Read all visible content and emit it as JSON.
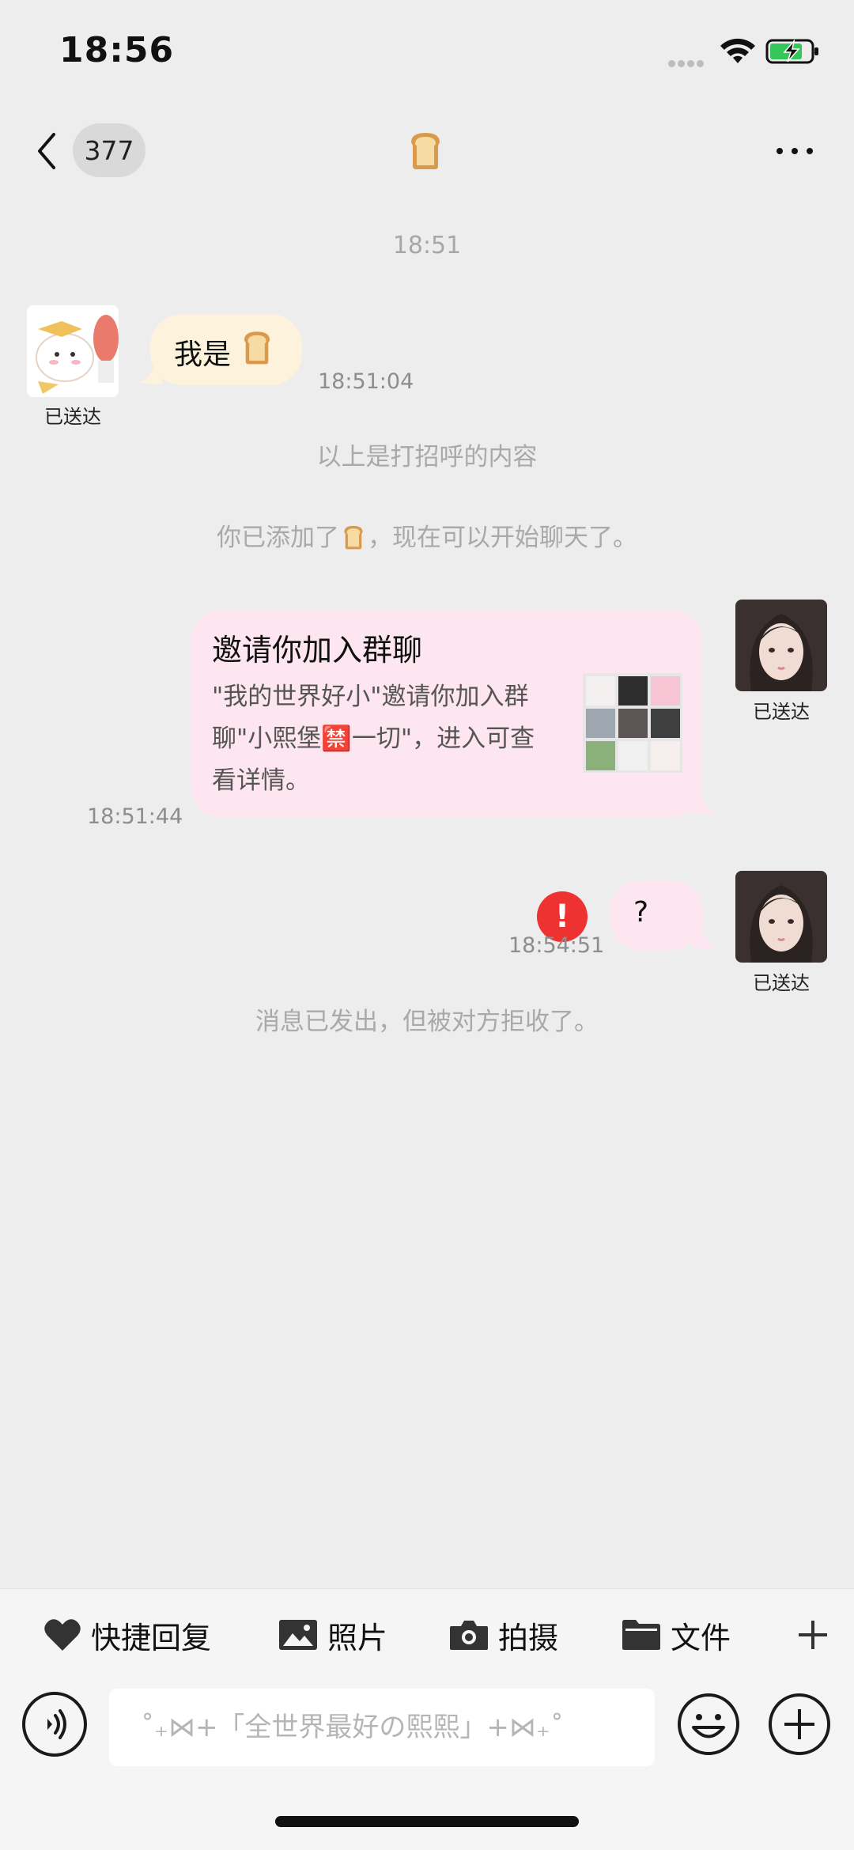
{
  "status_bar": {
    "time": "18:56"
  },
  "nav": {
    "unread_count": "377",
    "title_icon": "bread-emoji"
  },
  "messages": {
    "time_divider": "18:51",
    "incoming": {
      "text": "我是",
      "emoji": "bread-emoji",
      "time": "18:51:04",
      "delivered": "已送达"
    },
    "greeting_note": "以上是打招呼的内容",
    "added_note_prefix": "你已添加了",
    "added_note_suffix": "，现在可以开始聊天了。",
    "invite": {
      "title": "邀请你加入群聊",
      "desc_line1": "\"我的世界好小\"邀请你加入群",
      "desc_line2": "聊\"小熙堡🈲一切\"，进入可查",
      "desc_line3": "看详情。",
      "time": "18:51:44",
      "delivered": "已送达"
    },
    "question": {
      "text": "?",
      "time": "18:54:51",
      "delivered": "已送达",
      "error_mark": "!"
    },
    "rejected_note": "消息已发出，但被对方拒收了。"
  },
  "quick_bar": {
    "items": [
      {
        "label": "快捷回复",
        "icon": "heart-icon"
      },
      {
        "label": "照片",
        "icon": "image-icon"
      },
      {
        "label": "拍摄",
        "icon": "camera-icon"
      },
      {
        "label": "文件",
        "icon": "folder-icon"
      },
      {
        "label": "",
        "icon": "plus-icon"
      }
    ]
  },
  "input": {
    "placeholder": "˚₊⋈+「全世界最好の熙熙」+⋈₊˚"
  },
  "colors": {
    "background": "#ededed",
    "incoming_bubble": "#fdf3dc",
    "outgoing_bubble": "#fde6ef",
    "error_red": "#ee3131",
    "battery_green": "#35c759"
  }
}
